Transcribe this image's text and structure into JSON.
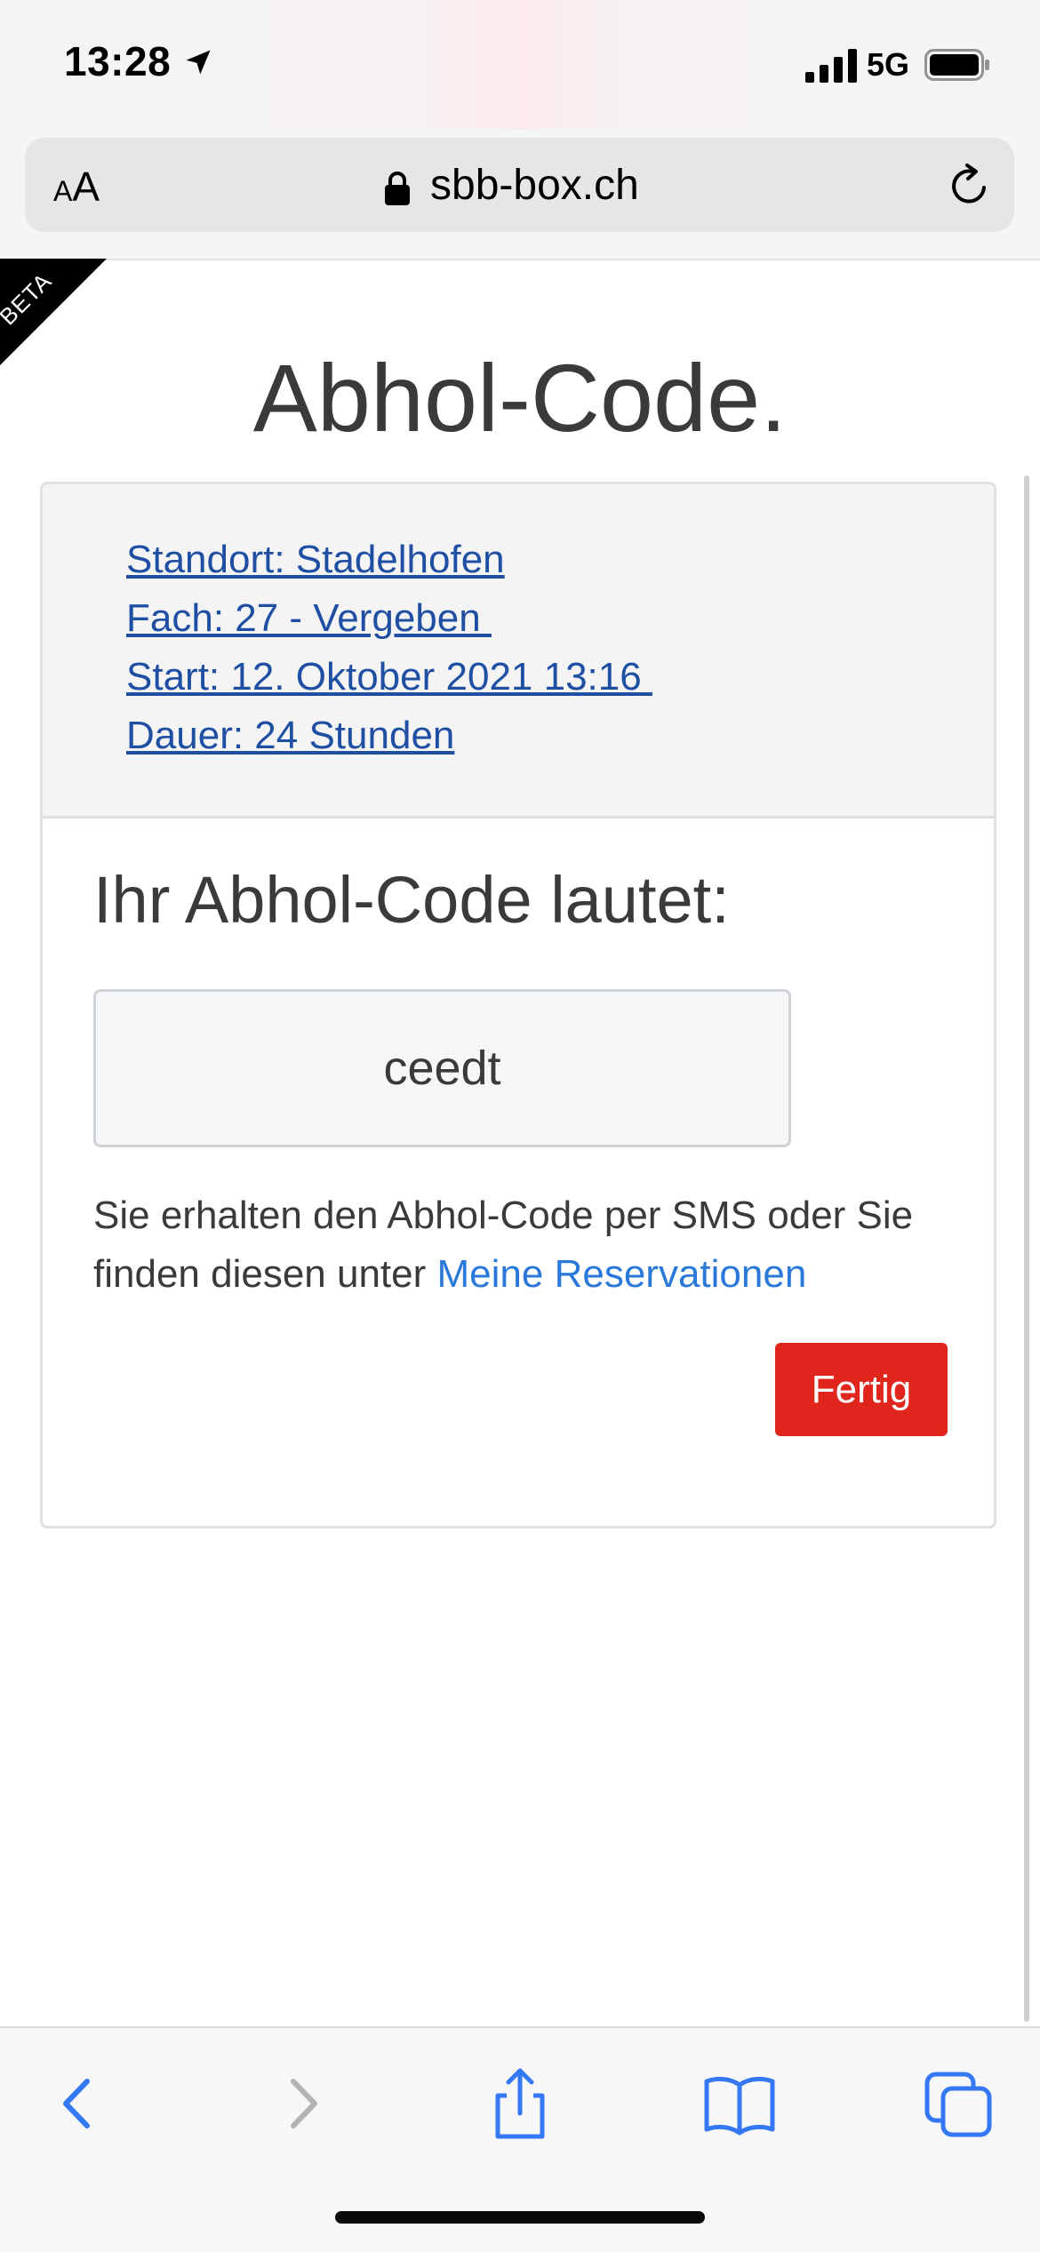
{
  "status_bar": {
    "time": "13:28",
    "network": "5G"
  },
  "browser": {
    "text_size_small": "A",
    "text_size_big": "A",
    "domain": "sbb-box.ch"
  },
  "ribbon": {
    "label": "BETA"
  },
  "page": {
    "title": "Abhol-Code.",
    "info": {
      "standort": "Standort: Stadelhofen",
      "fach": "Fach: 27 - Vergeben ",
      "start": "Start: 12. Oktober 2021 13:16 ",
      "dauer": "Dauer: 24 Stunden"
    },
    "code_heading": "Ihr Abhol-Code lautet:",
    "code_value": "ceedt",
    "note_text": "Sie erhalten den Abhol-Code per SMS oder Sie finden diesen unter ",
    "note_link": "Meine Reservationen",
    "done_button": "Fertig"
  },
  "colors": {
    "accent_red": "#e0261c",
    "link_blue": "#2a78d9",
    "info_link": "#1f4fa3",
    "ios_blue": "#3478f6"
  }
}
